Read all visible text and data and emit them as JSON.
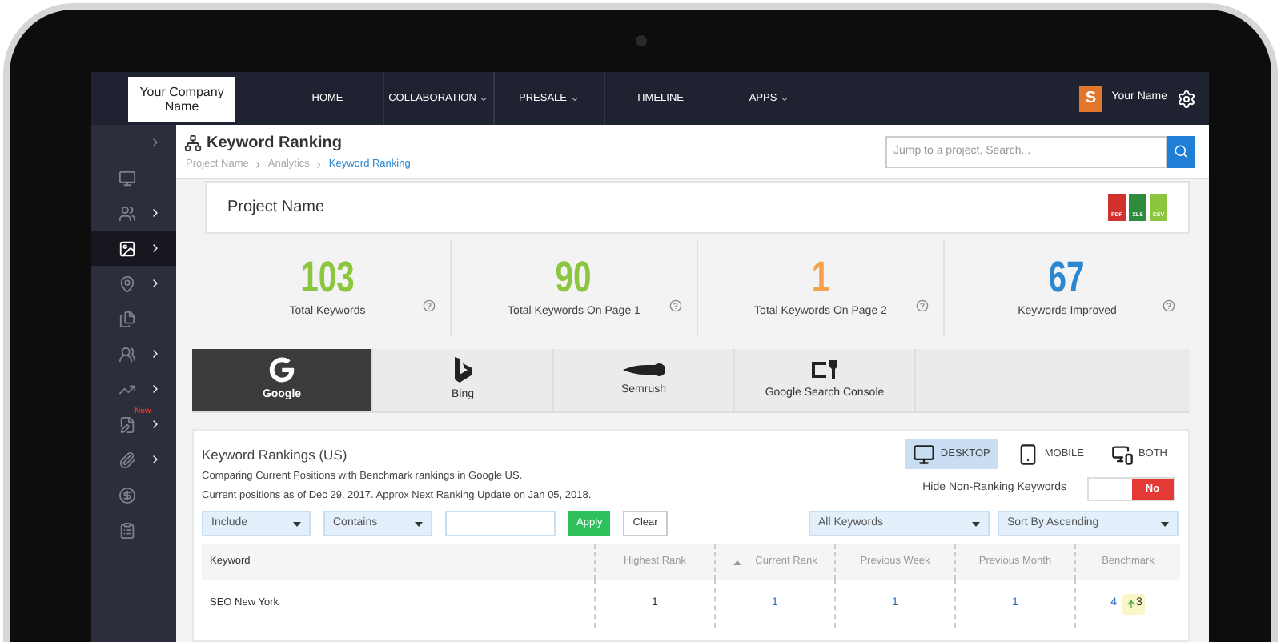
{
  "nav": {
    "logo": "Your Company Name",
    "items": [
      {
        "label": "HOME",
        "caret": false
      },
      {
        "label": "COLLABORATION",
        "caret": true
      },
      {
        "label": "PRESALE",
        "caret": true
      },
      {
        "label": "TIMELINE",
        "caret": false
      },
      {
        "label": "APPS",
        "caret": true
      }
    ],
    "user": {
      "initial": "S",
      "name": "Your Name"
    }
  },
  "sidebar": {
    "items": [
      {
        "kind": "toggle",
        "arrow": true,
        "selected": false
      },
      {
        "kind": "monitor",
        "arrow": false,
        "selected": false
      },
      {
        "kind": "users",
        "arrow": true,
        "selected": false
      },
      {
        "kind": "image",
        "arrow": true,
        "selected": true
      },
      {
        "kind": "pin",
        "arrow": true,
        "selected": false
      },
      {
        "kind": "files",
        "arrow": false,
        "selected": false
      },
      {
        "kind": "group",
        "arrow": true,
        "selected": false
      },
      {
        "kind": "chart",
        "arrow": true,
        "selected": false
      },
      {
        "kind": "edit",
        "arrow": true,
        "selected": false,
        "badge": "New"
      },
      {
        "kind": "clip",
        "arrow": true,
        "selected": false
      },
      {
        "kind": "dollar",
        "arrow": false,
        "selected": false
      },
      {
        "kind": "clipboard",
        "arrow": false,
        "selected": false
      }
    ]
  },
  "header": {
    "title": "Keyword Ranking",
    "breadcrumb": [
      {
        "label": "Project Name",
        "current": false
      },
      {
        "label": "Analytics",
        "current": false
      },
      {
        "label": "Keyword Ranking",
        "current": true
      }
    ],
    "search": {
      "placeholder": "Jump to a project, Search..."
    }
  },
  "project": {
    "name": "Project Name",
    "exports": [
      {
        "label": "PDF",
        "color": "#d0312d"
      },
      {
        "label": "XLS",
        "color": "#2e8b3e"
      },
      {
        "label": "CSV",
        "color": "#8cc63f"
      }
    ]
  },
  "stats": [
    {
      "value": "103",
      "label": "Total Keywords",
      "color": "#8cc63f"
    },
    {
      "value": "90",
      "label": "Total Keywords On Page 1",
      "color": "#8cc63f"
    },
    {
      "value": "1",
      "label": "Total Keywords On Page 2",
      "color": "#f7a24b"
    },
    {
      "value": "67",
      "label": "Keywords Improved",
      "color": "#2a87d0"
    }
  ],
  "engines": [
    {
      "kind": "google",
      "label": "Google",
      "selected": true
    },
    {
      "kind": "bing",
      "label": "Bing",
      "selected": false
    },
    {
      "kind": "semrush",
      "label": "Semrush",
      "selected": false
    },
    {
      "kind": "console",
      "label": "Google Search Console",
      "selected": false
    }
  ],
  "rankings": {
    "title": "Keyword Rankings (US)",
    "lines": [
      "Comparing Current Positions with Benchmark rankings in Google US.",
      "Current positions as of Dec 29, 2017. Approx Next Ranking Update on Jan 05, 2018."
    ],
    "devices": [
      {
        "kind": "desktop",
        "label": "DESKTOP",
        "selected": true
      },
      {
        "kind": "mobile",
        "label": "MOBILE",
        "selected": false
      },
      {
        "kind": "both",
        "label": "BOTH",
        "selected": false
      }
    ],
    "toggle": {
      "label": "Hide Non-Ranking Keywords",
      "on": false,
      "text": "No"
    },
    "filters": {
      "include": "Include",
      "match": "Contains",
      "apply": "Apply",
      "clear": "Clear",
      "scope": "All Keywords",
      "sort": "Sort By Ascending"
    },
    "columns": [
      {
        "label": "Keyword",
        "sorted": false
      },
      {
        "label": "Highest Rank",
        "sorted": false
      },
      {
        "label": "Current Rank",
        "sorted": true
      },
      {
        "label": "Previous Week",
        "sorted": false
      },
      {
        "label": "Previous Month",
        "sorted": false
      },
      {
        "label": "Benchmark",
        "sorted": false
      }
    ],
    "rows": [
      {
        "keyword": "SEO New York",
        "highest": "1",
        "current": "1",
        "week": "1",
        "month": "1",
        "benchmark": "4",
        "change": "3"
      }
    ]
  }
}
